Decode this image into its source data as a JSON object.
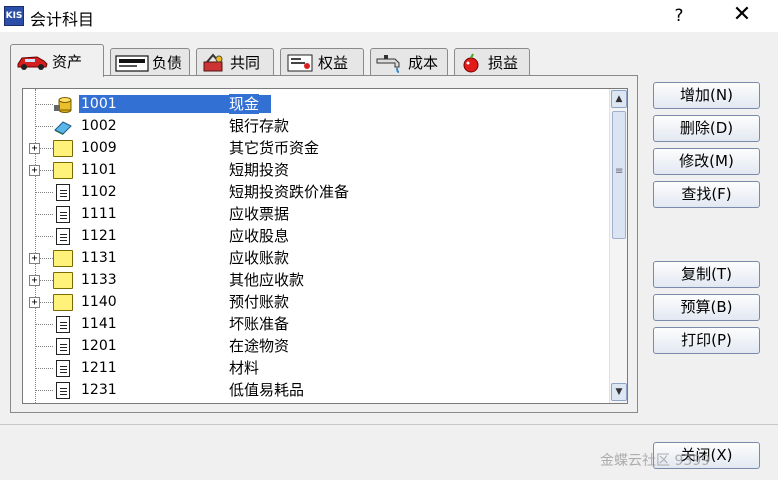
{
  "window": {
    "title": "会计科目",
    "app_icon_text": "KIS",
    "help_label": "?",
    "close_label": "✕"
  },
  "tabs": [
    {
      "label": "资产",
      "icon": "car-icon",
      "active": true
    },
    {
      "label": "负债",
      "icon": "credit-card-icon",
      "active": false
    },
    {
      "label": "共同",
      "icon": "tools-icon",
      "active": false
    },
    {
      "label": "权益",
      "icon": "certificate-icon",
      "active": false
    },
    {
      "label": "成本",
      "icon": "faucet-icon",
      "active": false
    },
    {
      "label": "损益",
      "icon": "apple-icon",
      "active": false
    }
  ],
  "tree": {
    "rows": [
      {
        "code": "1001",
        "name": "现金",
        "icon": "coins-icon",
        "expandable": false,
        "selected": true
      },
      {
        "code": "1002",
        "name": "银行存款",
        "icon": "bank-card-icon",
        "expandable": false,
        "selected": false
      },
      {
        "code": "1009",
        "name": "其它货币资金",
        "icon": "folder-icon",
        "expandable": true,
        "selected": false
      },
      {
        "code": "1101",
        "name": "短期投资",
        "icon": "folder-icon",
        "expandable": true,
        "selected": false
      },
      {
        "code": "1102",
        "name": "短期投资跌价准备",
        "icon": "document-icon",
        "expandable": false,
        "selected": false
      },
      {
        "code": "1111",
        "name": "应收票据",
        "icon": "document-icon",
        "expandable": false,
        "selected": false
      },
      {
        "code": "1121",
        "name": "应收股息",
        "icon": "document-icon",
        "expandable": false,
        "selected": false
      },
      {
        "code": "1131",
        "name": "应收账款",
        "icon": "folder-icon",
        "expandable": true,
        "selected": false
      },
      {
        "code": "1133",
        "name": "其他应收款",
        "icon": "folder-icon",
        "expandable": true,
        "selected": false
      },
      {
        "code": "1140",
        "name": "预付账款",
        "icon": "folder-icon",
        "expandable": true,
        "selected": false
      },
      {
        "code": "1141",
        "name": "坏账准备",
        "icon": "document-icon",
        "expandable": false,
        "selected": false
      },
      {
        "code": "1201",
        "name": "在途物资",
        "icon": "document-icon",
        "expandable": false,
        "selected": false
      },
      {
        "code": "1211",
        "name": "材料",
        "icon": "document-icon",
        "expandable": false,
        "selected": false
      },
      {
        "code": "1231",
        "name": "低值易耗品",
        "icon": "document-icon",
        "expandable": false,
        "selected": false
      }
    ],
    "expander_symbol": "+"
  },
  "buttons": {
    "add": "增加(N)",
    "delete": "删除(D)",
    "modify": "修改(M)",
    "find": "查找(F)",
    "copy": "复制(T)",
    "budget": "预算(B)",
    "print": "打印(P)",
    "close": "关闭(X)"
  },
  "watermark": "金蝶云社区 9399"
}
